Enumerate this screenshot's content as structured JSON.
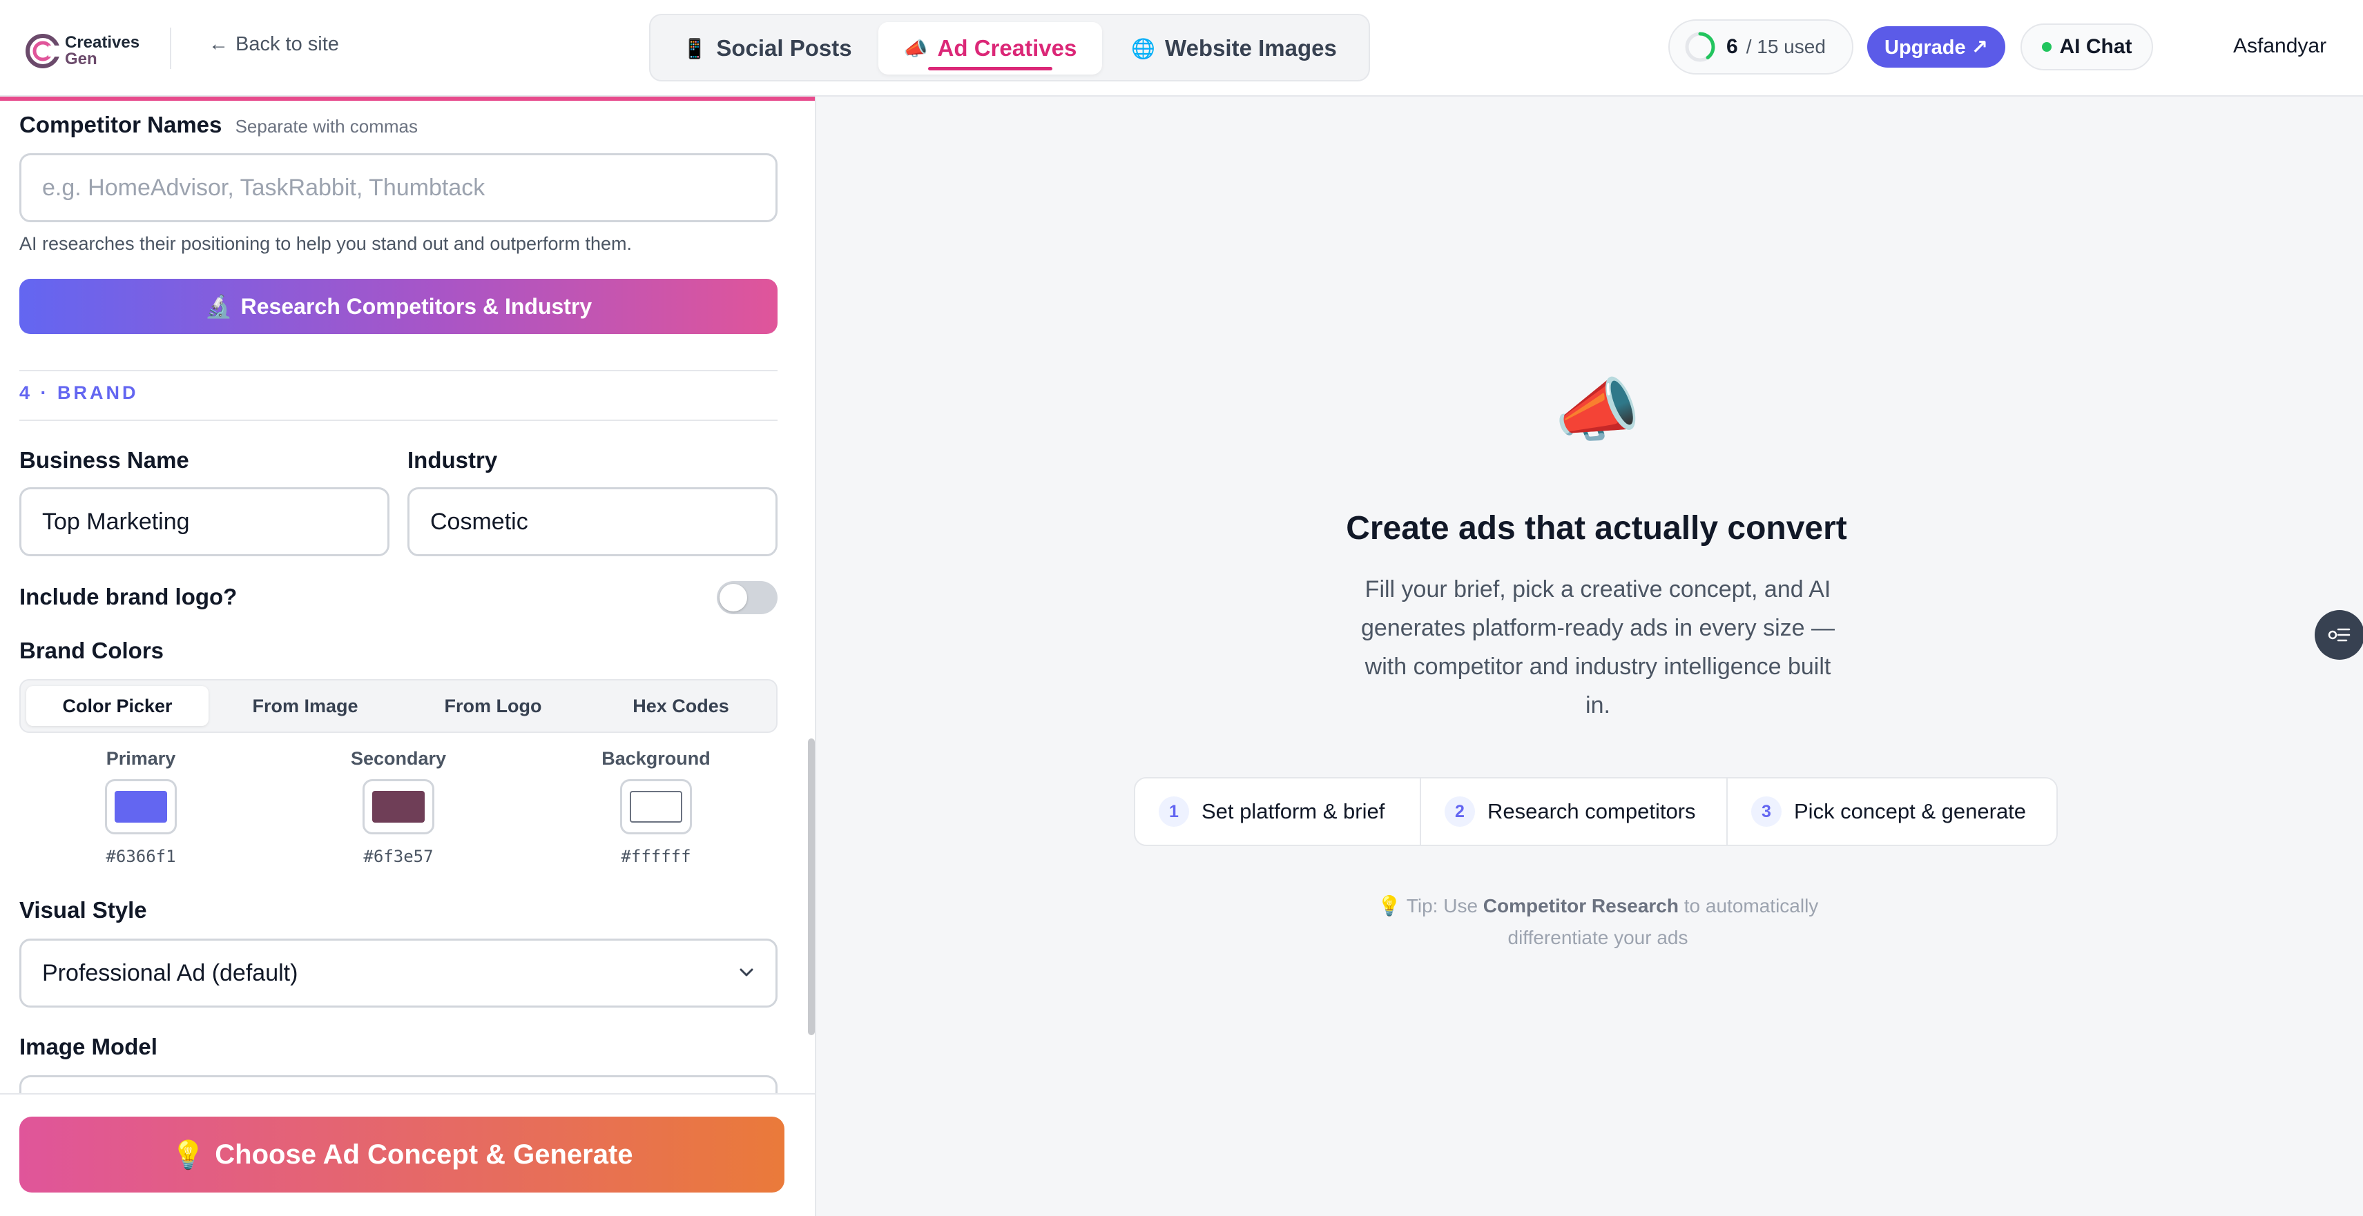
{
  "header": {
    "logo_line1": "Creatives",
    "logo_line2": "Gen",
    "back_label": "Back to site",
    "tabs": [
      {
        "label": "Social Posts",
        "icon": "📱"
      },
      {
        "label": "Ad Creatives",
        "icon": "📣"
      },
      {
        "label": "Website Images",
        "icon": "🌐"
      }
    ],
    "active_tab": "Ad Creatives",
    "usage": {
      "used": "6",
      "total_label": "/ 15 used",
      "fraction": 0.4
    },
    "upgrade_label": "Upgrade ↗",
    "ai_chat_label": "AI Chat",
    "username": "Asfandyar"
  },
  "form": {
    "competitors": {
      "label": "Competitor Names",
      "hint": "Separate with commas",
      "placeholder": "e.g. HomeAdvisor, TaskRabbit, Thumbtack",
      "helper": "AI researches their positioning to help you stand out and outperform them."
    },
    "research_button": "Research Competitors & Industry",
    "research_icon": "🔬",
    "brand_section_title": "4 · BRAND",
    "business_name": {
      "label": "Business Name",
      "value": "Top Marketing"
    },
    "industry": {
      "label": "Industry",
      "value": "Cosmetic"
    },
    "include_logo": {
      "label": "Include brand logo?",
      "enabled": false
    },
    "brand_colors": {
      "label": "Brand Colors",
      "modes": [
        "Color Picker",
        "From Image",
        "From Logo",
        "Hex Codes"
      ],
      "active_mode": "Color Picker",
      "swatches": [
        {
          "label": "Primary",
          "hex": "#6366f1"
        },
        {
          "label": "Secondary",
          "hex": "#6f3e57"
        },
        {
          "label": "Background",
          "hex": "#ffffff"
        }
      ]
    },
    "visual_style": {
      "label": "Visual Style",
      "value": "Professional Ad (default)"
    },
    "image_model": {
      "label": "Image Model"
    },
    "generate_button": "Choose Ad Concept & Generate",
    "generate_icon": "💡"
  },
  "hero": {
    "icon": "📣",
    "title": "Create ads that actually convert",
    "description": "Fill your brief, pick a creative concept, and AI generates platform-ready ads in every size — with competitor and industry intelligence built in.",
    "steps": [
      {
        "num": "1",
        "label": "Set platform & brief"
      },
      {
        "num": "2",
        "label": "Research competitors"
      },
      {
        "num": "3",
        "label": "Pick concept & generate"
      }
    ],
    "tip_prefix": "💡 Tip: Use ",
    "tip_bold": "Competitor Research",
    "tip_suffix": " to automatically differentiate your ads"
  },
  "colors": {
    "brand_accent": "#6366f1",
    "active_tab": "#db2777",
    "generate_start": "#e0559a",
    "generate_end": "#ea7a3a"
  }
}
